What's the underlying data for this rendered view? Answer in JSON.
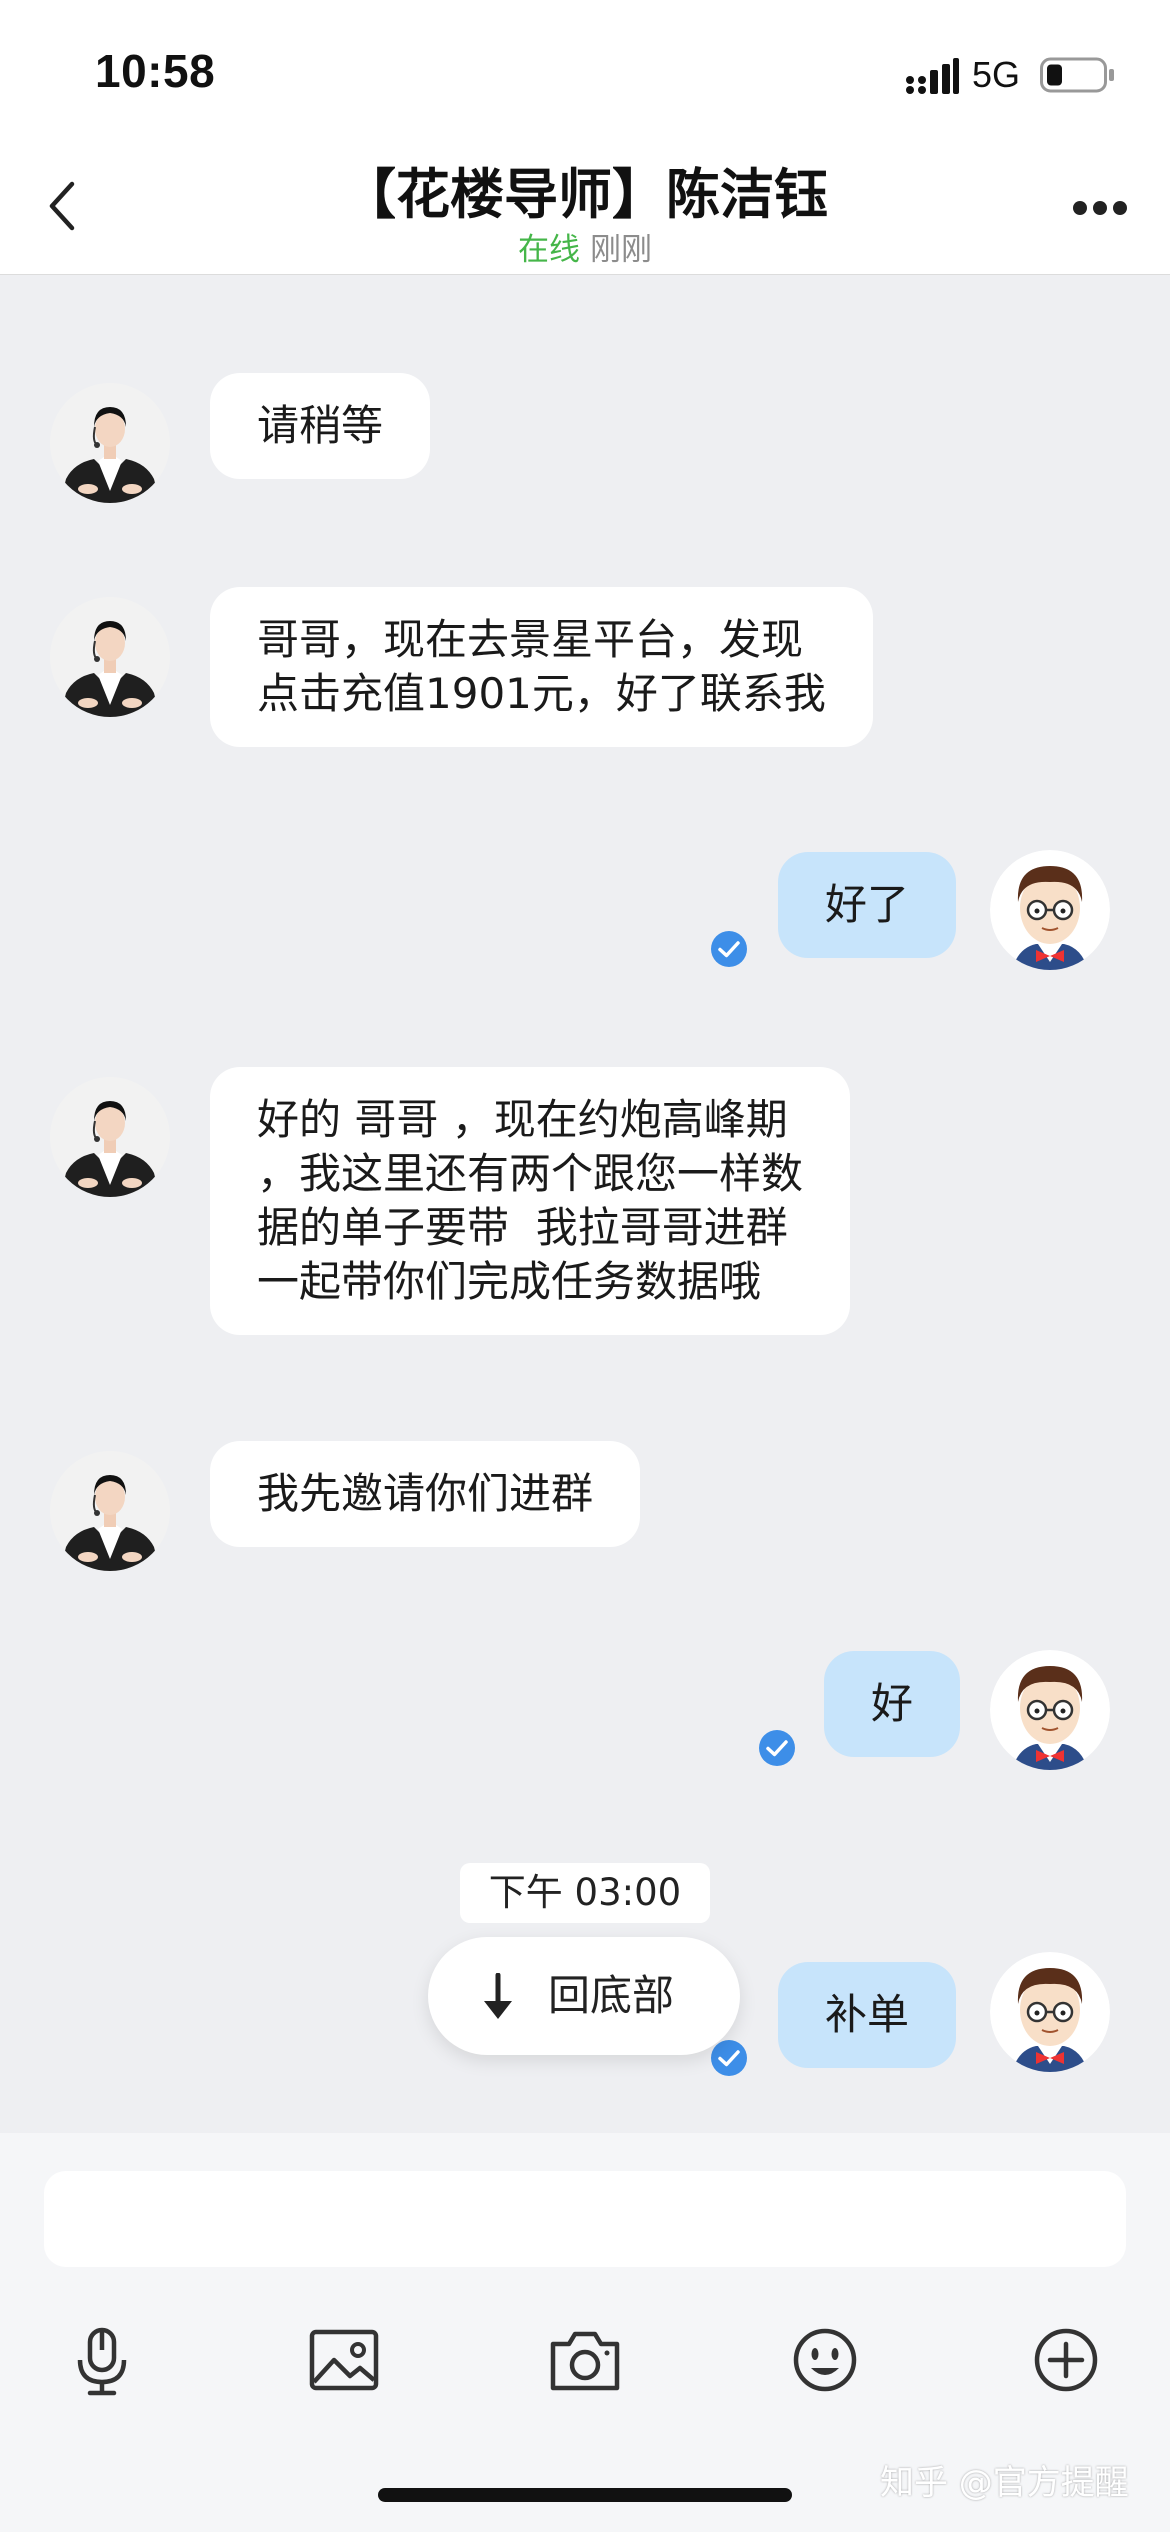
{
  "status_bar": {
    "time": "10:58",
    "network": "5G"
  },
  "header": {
    "back_icon": "chevron-left-icon",
    "title": "【花楼导师】陈洁钰",
    "presence": "在线",
    "last_seen": "刚刚",
    "more_icon": "more-dots-icon"
  },
  "colors": {
    "online_green": "#45b649",
    "incoming_bubble": "#ffffff",
    "outgoing_bubble": "#c7e4fb",
    "read_check": "#3d8ee8",
    "chat_background": "#eeeff2"
  },
  "messages": [
    {
      "direction": "incoming",
      "text": "请稍等"
    },
    {
      "direction": "incoming",
      "text": "哥哥，现在去景星平台，发现\n点击充值1901元，好了联系我"
    },
    {
      "direction": "outgoing",
      "text": "好了",
      "read": true
    },
    {
      "direction": "incoming",
      "text": "好的 哥哥 ，现在约炮高峰期\n，我这里还有两个跟您一样数\n据的单子要带  我拉哥哥进群\n一起带你们完成任务数据哦"
    },
    {
      "direction": "incoming",
      "text": "我先邀请你们进群"
    },
    {
      "direction": "outgoing",
      "text": "好",
      "read": true
    },
    {
      "direction": "outgoing",
      "text": "补单",
      "read": true
    }
  ],
  "timestamp_chip": "下午 03:00",
  "jump_to_bottom": {
    "icon": "arrow-down-icon",
    "label": "回底部"
  },
  "composer": {
    "value": "",
    "tools": [
      "microphone-icon",
      "image-icon",
      "camera-icon",
      "emoji-icon",
      "plus-icon"
    ]
  },
  "watermark": "知乎 @官方提醒"
}
